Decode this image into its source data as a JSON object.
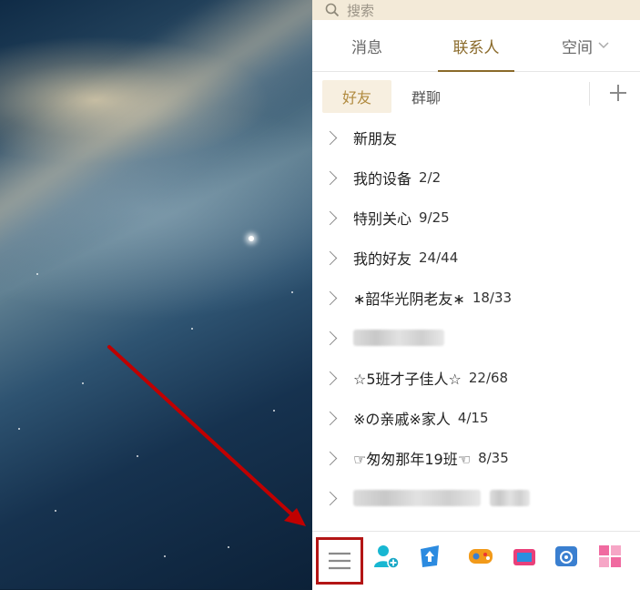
{
  "search": {
    "placeholder": "搜索"
  },
  "tabs": [
    {
      "label": "消息",
      "active": false
    },
    {
      "label": "联系人",
      "active": true
    },
    {
      "label": "空间",
      "active": false,
      "has_dropdown": true
    }
  ],
  "subtabs": [
    {
      "label": "好友",
      "active": true
    },
    {
      "label": "群聊",
      "active": false
    }
  ],
  "add_icon": "plus-icon",
  "contact_groups": [
    {
      "name": "新朋友",
      "count": ""
    },
    {
      "name": "我的设备",
      "count": "2/2"
    },
    {
      "name": "特别关心",
      "count": "9/25"
    },
    {
      "name": "我的好友",
      "count": "24/44"
    },
    {
      "name": "∗韶华光阴老友∗",
      "count": "18/33"
    },
    {
      "name": "",
      "count": "",
      "blurred": true
    },
    {
      "name": "☆5班才子佳人☆",
      "count": "22/68"
    },
    {
      "name": "※の亲戚※家人",
      "count": "4/15"
    },
    {
      "name": "☞匆匆那年19班☜",
      "count": "8/35"
    },
    {
      "name": "",
      "count": "",
      "blurred": true
    }
  ],
  "bottom_bar": [
    {
      "icon": "menu-icon",
      "highlighted": true
    },
    {
      "icon": "add-contact-icon"
    },
    {
      "icon": "upload-icon"
    },
    {
      "icon": "game-icon"
    },
    {
      "icon": "screenshot-icon"
    },
    {
      "icon": "weiyun-icon"
    },
    {
      "icon": "apps-icon"
    }
  ],
  "colors": {
    "accent": "#8a6a2a",
    "search_bg": "#f3ead8",
    "highlight_box": "#b31515",
    "arrow": "#c00000"
  }
}
